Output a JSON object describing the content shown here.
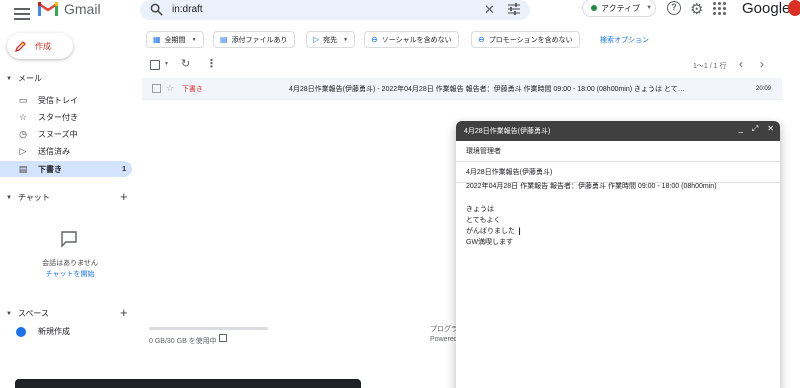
{
  "header": {
    "app_name": "Gmail",
    "search_value": "in:draft",
    "status": "アクティブ",
    "google_logo": "Google"
  },
  "nav": {
    "compose_label": "作成",
    "mail_section": "メール",
    "items": [
      {
        "label": "受信トレイ",
        "icon": "inbox-icon",
        "count": ""
      },
      {
        "label": "スター付き",
        "icon": "star-icon",
        "count": ""
      },
      {
        "label": "スヌーズ中",
        "icon": "snooze-icon",
        "count": ""
      },
      {
        "label": "送信済み",
        "icon": "send-icon",
        "count": ""
      },
      {
        "label": "下書き",
        "icon": "draft-icon",
        "count": "1"
      }
    ],
    "chat_section": "チャット",
    "chat_empty": "会話はありません",
    "chat_start": "チャットを開始",
    "spaces_section": "スペース",
    "new_space": "新規作成"
  },
  "filters": {
    "chips": [
      {
        "label": "全期間",
        "icon": "calendar-icon"
      },
      {
        "label": "添付ファイルあり",
        "icon": "attachment-icon"
      },
      {
        "label": "宛先",
        "icon": "send-icon"
      },
      {
        "label": "ソーシャルを含めない",
        "icon": "minus-circle-icon"
      },
      {
        "label": "プロモーションを含めない",
        "icon": "minus-circle-icon"
      }
    ],
    "advanced": "検索オプション"
  },
  "toolbar": {
    "pager": "1～1 / 1 行"
  },
  "messages": [
    {
      "sender": "下書き",
      "subject": "4月28日作業報告(伊藤勇斗) - 2022年04月28日 作業報告 報告者：伊藤勇斗 作業時間 09:00 - 18:00 (08h00min) きょうは とて…",
      "time": "20:09"
    }
  ],
  "footer": {
    "storage": "0 GB/30 GB を使用中",
    "right_line1": "プログラ",
    "right_line2": "Powered"
  },
  "compose_window": {
    "title": "4月28日作業報告(伊藤勇斗)",
    "to": "環境管理者",
    "subject": "4月28日作業報告(伊藤勇斗)",
    "summary": "2022年04月28日 作業報告 報告者：伊藤勇斗 作業時間 09:00 - 18:00 (08h00min)",
    "body_lines": [
      "きょうは",
      "とてもよく",
      "がんばりました",
      "GW満喫します"
    ]
  },
  "colors": {
    "accent_blue": "#1a73e8",
    "draft_red": "#d93025",
    "active_nav": "#d3e3fd",
    "compose_header": "#404040"
  }
}
